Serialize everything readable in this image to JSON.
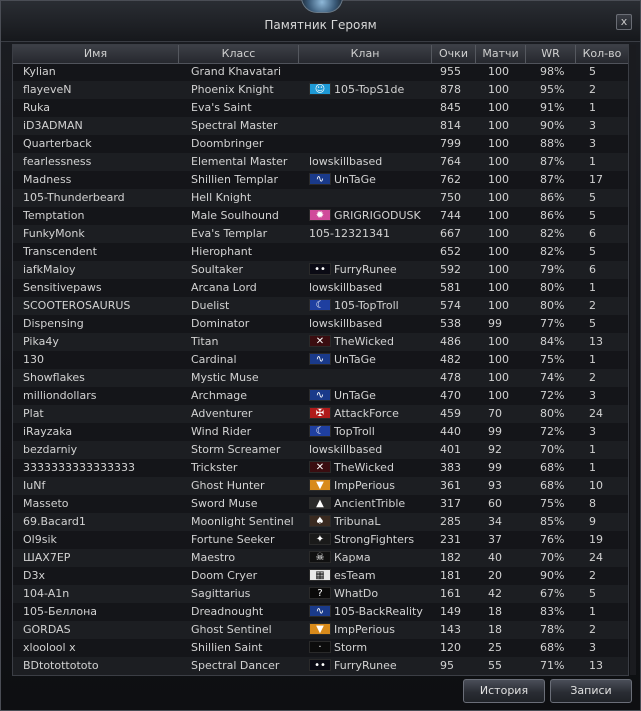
{
  "window": {
    "title": "Памятник Героям",
    "close_label": "x"
  },
  "columns": [
    "Имя",
    "Класс",
    "Клан",
    "Очки",
    "Матчи",
    "WR",
    "Кол-во"
  ],
  "rows": [
    {
      "name": "Kylian",
      "class": "Grand Khavatari",
      "clan": "",
      "crest": "",
      "points": "955",
      "matches": "100",
      "wr": "98%",
      "count": "5"
    },
    {
      "name": "flayeveN",
      "class": "Phoenix Knight",
      "clan": "105-TopS1de",
      "crest": "smile-crest-icon",
      "points": "878",
      "matches": "100",
      "wr": "95%",
      "count": "2"
    },
    {
      "name": "Ruka",
      "class": "Eva's Saint",
      "clan": "",
      "crest": "",
      "points": "845",
      "matches": "100",
      "wr": "91%",
      "count": "1"
    },
    {
      "name": "iD3ADMAN",
      "class": "Spectral Master",
      "clan": "",
      "crest": "",
      "points": "814",
      "matches": "100",
      "wr": "90%",
      "count": "3"
    },
    {
      "name": "Quarterback",
      "class": "Doombringer",
      "clan": "",
      "crest": "",
      "points": "799",
      "matches": "100",
      "wr": "88%",
      "count": "3"
    },
    {
      "name": "fearlessness",
      "class": "Elemental Master",
      "clan": "lowskillbased",
      "crest": "",
      "points": "764",
      "matches": "100",
      "wr": "87%",
      "count": "1"
    },
    {
      "name": "Madness",
      "class": "Shillien Templar",
      "clan": "UnTaGe",
      "crest": "blue-swirl-crest-icon",
      "points": "762",
      "matches": "100",
      "wr": "87%",
      "count": "17"
    },
    {
      "name": "105-Thunderbeard",
      "class": "Hell Knight",
      "clan": "",
      "crest": "",
      "points": "750",
      "matches": "100",
      "wr": "86%",
      "count": "5"
    },
    {
      "name": "Temptation",
      "class": "Male Soulhound",
      "clan": "GRIGRIGODUSK",
      "crest": "colorful-crest-icon",
      "points": "744",
      "matches": "100",
      "wr": "86%",
      "count": "5"
    },
    {
      "name": "FunkyMonk",
      "class": "Eva's Templar",
      "clan": "105-12321341",
      "crest": "",
      "points": "667",
      "matches": "100",
      "wr": "82%",
      "count": "6"
    },
    {
      "name": "Transcendent",
      "class": "Hierophant",
      "clan": "",
      "crest": "",
      "points": "652",
      "matches": "100",
      "wr": "82%",
      "count": "5"
    },
    {
      "name": "iafkMaloy",
      "class": "Soultaker",
      "clan": "FurryRunee",
      "crest": "eyes-crest-icon",
      "points": "592",
      "matches": "100",
      "wr": "79%",
      "count": "6"
    },
    {
      "name": "Sensitivepaws",
      "class": "Arcana Lord",
      "clan": "lowskillbased",
      "crest": "",
      "points": "581",
      "matches": "100",
      "wr": "80%",
      "count": "1"
    },
    {
      "name": "SCOOTEROSAURUS",
      "class": "Duelist",
      "clan": "105-TopTroll",
      "crest": "moon-crest-icon",
      "points": "574",
      "matches": "100",
      "wr": "80%",
      "count": "2"
    },
    {
      "name": "Dispensing",
      "class": "Dominator",
      "clan": "lowskillbased",
      "crest": "",
      "points": "538",
      "matches": "99",
      "wr": "77%",
      "count": "5"
    },
    {
      "name": "Pika4y",
      "class": "Titan",
      "clan": "TheWicked",
      "crest": "red-x-crest-icon",
      "points": "486",
      "matches": "100",
      "wr": "84%",
      "count": "13"
    },
    {
      "name": "130",
      "class": "Cardinal",
      "clan": "UnTaGe",
      "crest": "blue-swirl-crest-icon",
      "points": "482",
      "matches": "100",
      "wr": "75%",
      "count": "1"
    },
    {
      "name": "Showflakes",
      "class": "Mystic Muse",
      "clan": "",
      "crest": "",
      "points": "478",
      "matches": "100",
      "wr": "74%",
      "count": "2"
    },
    {
      "name": "milliondollars",
      "class": "Archmage",
      "clan": "UnTaGe",
      "crest": "blue-swirl-crest-icon",
      "points": "470",
      "matches": "100",
      "wr": "72%",
      "count": "3"
    },
    {
      "name": "Plat",
      "class": "Adventurer",
      "clan": "AttackForce",
      "crest": "red-wings-crest-icon",
      "points": "459",
      "matches": "70",
      "wr": "80%",
      "count": "24"
    },
    {
      "name": "iRayzaka",
      "class": "Wind Rider",
      "clan": "TopTroll",
      "crest": "moon-crest-icon",
      "points": "440",
      "matches": "99",
      "wr": "72%",
      "count": "3"
    },
    {
      "name": "bezdarniy",
      "class": "Storm Screamer",
      "clan": "lowskillbased",
      "crest": "",
      "points": "401",
      "matches": "92",
      "wr": "70%",
      "count": "1"
    },
    {
      "name": "3333333333333333",
      "class": "Trickster",
      "clan": "TheWicked",
      "crest": "red-x-crest-icon",
      "points": "383",
      "matches": "99",
      "wr": "68%",
      "count": "1"
    },
    {
      "name": "IuNf",
      "class": "Ghost Hunter",
      "clan": "ImpPerious",
      "crest": "orange-shield-crest-icon",
      "points": "361",
      "matches": "93",
      "wr": "68%",
      "count": "10"
    },
    {
      "name": "Masseto",
      "class": "Sword Muse",
      "clan": "AncientTrible",
      "crest": "flame-crest-icon",
      "points": "317",
      "matches": "60",
      "wr": "75%",
      "count": "8"
    },
    {
      "name": "69.Bacard1",
      "class": "Moonlight Sentinel",
      "clan": "TribunaL",
      "crest": "eagle-crest-icon",
      "points": "285",
      "matches": "34",
      "wr": "85%",
      "count": "9"
    },
    {
      "name": "Ol9sik",
      "class": "Fortune Seeker",
      "clan": "StrongFighters",
      "crest": "star-crest-icon",
      "points": "231",
      "matches": "37",
      "wr": "76%",
      "count": "19"
    },
    {
      "name": "ШАХ7ЕР",
      "class": "Maestro",
      "clan": "Карма",
      "crest": "skull-crest-icon",
      "points": "182",
      "matches": "40",
      "wr": "70%",
      "count": "24"
    },
    {
      "name": "D3x",
      "class": "Doom Cryer",
      "clan": "esTeam",
      "crest": "pixel-crest-icon",
      "points": "181",
      "matches": "20",
      "wr": "90%",
      "count": "2"
    },
    {
      "name": "104-A1n",
      "class": "Sagittarius",
      "clan": "WhatDo",
      "crest": "question-crest-icon",
      "points": "161",
      "matches": "42",
      "wr": "67%",
      "count": "5"
    },
    {
      "name": "105-Беллона",
      "class": "Dreadnought",
      "clan": "105-BackReality",
      "crest": "blue-swirl-crest-icon",
      "points": "149",
      "matches": "18",
      "wr": "83%",
      "count": "1"
    },
    {
      "name": "GORDAS",
      "class": "Ghost Sentinel",
      "clan": "ImpPerious",
      "crest": "orange-shield-crest-icon",
      "points": "143",
      "matches": "18",
      "wr": "78%",
      "count": "2"
    },
    {
      "name": "xloolool x",
      "class": "Shillien Saint",
      "clan": "Storm",
      "crest": "dark-crest-icon",
      "points": "120",
      "matches": "25",
      "wr": "68%",
      "count": "3"
    },
    {
      "name": "BDtotottototo",
      "class": "Spectral Dancer",
      "clan": "FurryRunee",
      "crest": "eyes-crest-icon",
      "points": "95",
      "matches": "55",
      "wr": "71%",
      "count": "13"
    }
  ],
  "crest_colors": {
    "smile-crest-icon": "#1e9ad6",
    "blue-swirl-crest-icon": "#1a3a8a",
    "colorful-crest-icon": "#d04a9a",
    "eyes-crest-icon": "#0a0a14",
    "moon-crest-icon": "#1f3fa0",
    "red-x-crest-icon": "#3a0d10",
    "red-wings-crest-icon": "#b01a1a",
    "orange-shield-crest-icon": "#d88a1a",
    "flame-crest-icon": "#2a2a2a",
    "eagle-crest-icon": "#3a2a20",
    "star-crest-icon": "#1a1a1a",
    "skull-crest-icon": "#101010",
    "pixel-crest-icon": "#e8e8e8",
    "question-crest-icon": "#0a0a0a",
    "dark-crest-icon": "#0c0c0c"
  },
  "crest_glyphs": {
    "smile-crest-icon": "☺",
    "blue-swirl-crest-icon": "∿",
    "colorful-crest-icon": "✹",
    "eyes-crest-icon": "••",
    "moon-crest-icon": "☾",
    "red-x-crest-icon": "✕",
    "red-wings-crest-icon": "✠",
    "orange-shield-crest-icon": "▼",
    "flame-crest-icon": "▲",
    "eagle-crest-icon": "♠",
    "star-crest-icon": "✦",
    "skull-crest-icon": "☠",
    "pixel-crest-icon": "▦",
    "question-crest-icon": "?",
    "dark-crest-icon": "·"
  },
  "footer": {
    "history_label": "История",
    "records_label": "Записи"
  }
}
